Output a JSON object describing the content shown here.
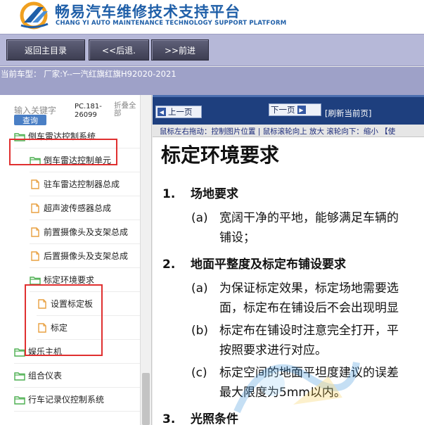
{
  "header": {
    "title": "畅易汽车维修技术支持平台",
    "subtitle": "CHANG YI AUTO MAINTENANCE TECHNOLOGY SUPPORT PLATFORM",
    "logo_icon": "chang-yi-logo-icon",
    "brand_color": "#1f5fa8"
  },
  "toolbar": {
    "home_label": "返回主目录",
    "back_label": "<<后退.",
    "forward_label": ">>前进"
  },
  "model": {
    "label": "当前车型： 厂家:Y--一汽红旗红旗H92020-2021"
  },
  "left_panel": {
    "search_placeholder": "输入关键字",
    "search_button": "查询",
    "pc_code": "PC.181-26099",
    "fold_all": "折叠全部",
    "tree": [
      {
        "label": "倒车雷达控制系统",
        "type": "folder",
        "level": 0
      },
      {
        "label": "倒车雷达控制单元",
        "type": "folder",
        "level": 1
      },
      {
        "label": "驻车雷达控制器总成",
        "type": "file",
        "level": 1
      },
      {
        "label": "超声波传感器总成",
        "type": "file",
        "level": 1
      },
      {
        "label": "前置摄像头及支架总成",
        "type": "file",
        "level": 1
      },
      {
        "label": "后置摄像头及支架总成",
        "type": "file",
        "level": 1
      },
      {
        "label": "标定环境要求",
        "type": "folder",
        "level": 1
      },
      {
        "label": "设置标定板",
        "type": "file",
        "level": 2
      },
      {
        "label": "标定",
        "type": "file",
        "level": 2
      },
      {
        "label": "娱乐主机",
        "type": "folder",
        "level": 0
      },
      {
        "label": "组合仪表",
        "type": "folder",
        "level": 0
      },
      {
        "label": "行车记录仪控制系统",
        "type": "folder",
        "level": 0
      }
    ]
  },
  "right_panel": {
    "prev_label": "上一页",
    "next_label": "下一页",
    "refresh_label": "[刷新当前页]",
    "hint": "鼠标左右拖动：控制图片位置 | 鼠标滚轮向上 放大  滚轮向下：缩小 【使",
    "doc": {
      "title": "标定环境要求",
      "s1_num": "1.",
      "s1_title": "场地要求",
      "s1a_tag": "(a)",
      "s1a_line1": "宽阔干净的平地，能够满足车辆的",
      "s1a_line2": "铺设；",
      "s2_num": "2.",
      "s2_title": "地面平整度及标定布铺设要求",
      "s2a_tag": "(a)",
      "s2a_line1": "为保证标定效果，标定场地需要选",
      "s2a_line2": "面，标定布在铺设后不会出现明显",
      "s2b_tag": "(b)",
      "s2b_line1": "标定布在铺设时注意完全打开，平",
      "s2b_line2": "按照要求进行对应。",
      "s2c_tag": "(c)",
      "s2c_line1": "标定空间的地面平坦度建议的误差",
      "s2c_line2": "最大限度为5mm以内。",
      "s3_num": "3.",
      "s3_title": "光照条件"
    }
  },
  "colors": {
    "toolbar_bg": "#b6b8d8",
    "model_bg": "#9ea1c8",
    "nav_bg": "#1e3f7e",
    "highlight": "#e03030",
    "folder_green": "#4caf50",
    "file_orange": "#e8a040"
  }
}
